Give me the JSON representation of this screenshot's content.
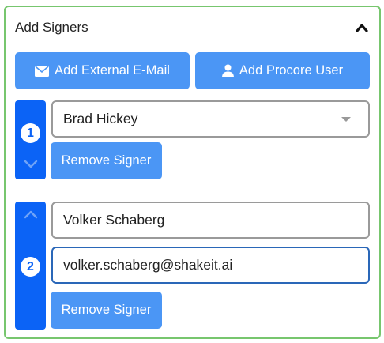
{
  "panel": {
    "title": "Add Signers",
    "collapse_icon": "chevron-up-icon"
  },
  "actions": {
    "add_external_email": {
      "label": "Add External E-Mail",
      "icon": "envelope-icon"
    },
    "add_procore_user": {
      "label": "Add Procore User",
      "icon": "user-icon"
    }
  },
  "signers": [
    {
      "order": "1",
      "type": "procore-user",
      "selected_user": "Brad Hickey",
      "remove_label": "Remove Signer"
    },
    {
      "order": "2",
      "type": "external",
      "name": "Volker Schaberg",
      "email": "volker.schaberg@shakeit.ai",
      "remove_label": "Remove Signer"
    }
  ],
  "colors": {
    "panel_border": "#77c66e",
    "button": "#4b96f5",
    "order_bar": "#0b63f6"
  }
}
